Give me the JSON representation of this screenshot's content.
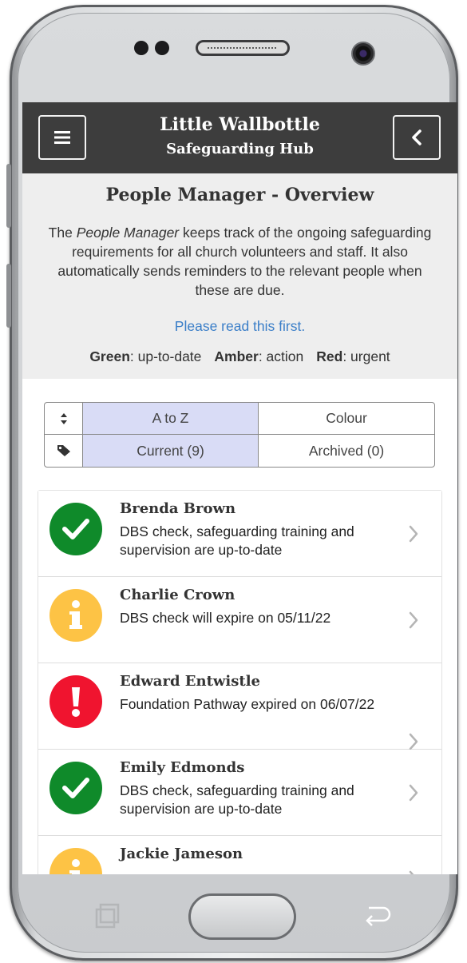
{
  "header": {
    "title_line1": "Little Wallbottle",
    "title_line2": "Safeguarding Hub",
    "menu_icon": "hamburger-menu-icon",
    "back_icon": "chevron-left-icon"
  },
  "overview": {
    "heading": "People Manager - Overview",
    "intro_pre": "The ",
    "intro_em": "People Manager",
    "intro_post": " keeps track of the ongoing safeguarding requirements for all church volunteers and staff.  It also automatically sends reminders to the relevant people when these are due.",
    "link": "Please read this first.",
    "legend": [
      {
        "label": "Green",
        "text": ": up-to-date"
      },
      {
        "label": "Amber",
        "text": ": action"
      },
      {
        "label": "Red",
        "text": ": urgent"
      }
    ]
  },
  "filters": {
    "sort_icon": "sort-icon",
    "tag_icon": "tag-icon",
    "sort_options": [
      "A to Z",
      "Colour"
    ],
    "sort_selected": "A to Z",
    "view_options": [
      "Current (9)",
      "Archived (0)"
    ],
    "view_selected": "Current (9)"
  },
  "people": [
    {
      "name": "Brenda Brown",
      "desc": "DBS check, safeguarding training and supervision are up-to-date",
      "status": "green",
      "icon": "check-icon"
    },
    {
      "name": "Charlie Crown",
      "desc": "DBS check will expire on 05/11/22",
      "status": "amber",
      "icon": "info-icon"
    },
    {
      "name": "Edward Entwistle",
      "desc": "Foundation Pathway expired on 06/07/22",
      "status": "red",
      "icon": "exclamation-icon"
    },
    {
      "name": "Emily Edmonds",
      "desc": "DBS check, safeguarding training and supervision are up-to-date",
      "status": "green",
      "icon": "check-icon"
    },
    {
      "name": "Jackie Jameson",
      "desc": "",
      "status": "amber",
      "icon": "info-icon"
    }
  ],
  "colors": {
    "green": "#0f8a2a",
    "amber": "#fdc345",
    "red": "#f0142f",
    "header_bg": "#3d3d3d",
    "link": "#3a7ec8",
    "selected_filter": "#d9dcf6"
  }
}
